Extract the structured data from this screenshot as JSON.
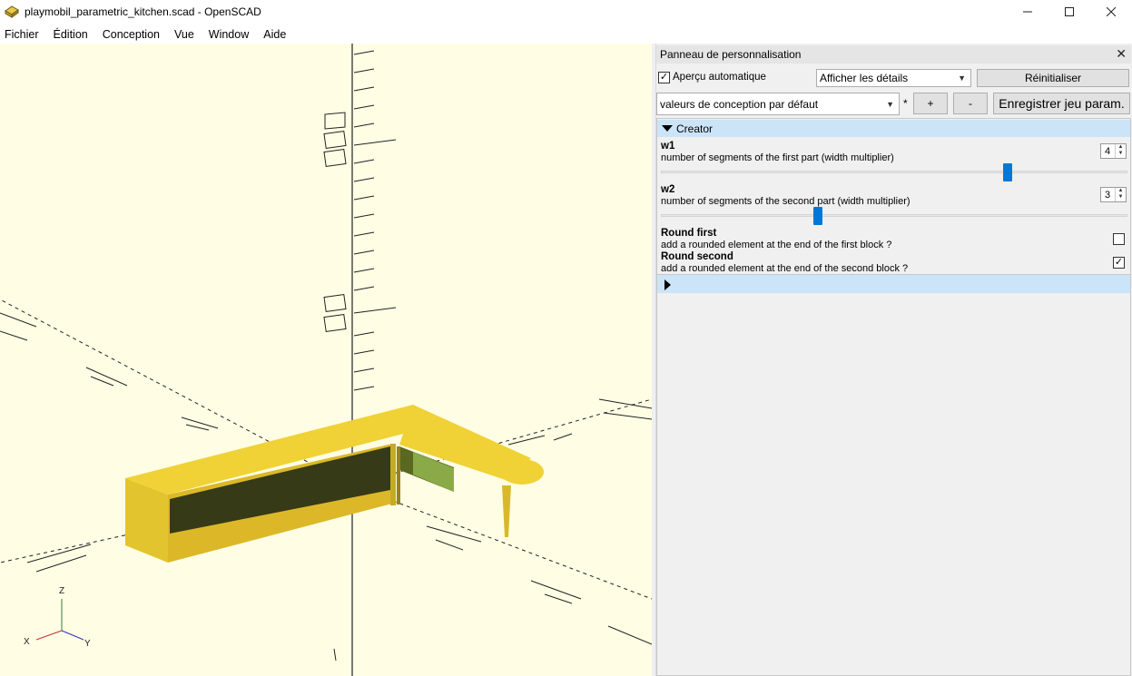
{
  "window": {
    "title": "playmobil_parametric_kitchen.scad - OpenSCAD",
    "controls": [
      "minimize",
      "maximize",
      "close"
    ]
  },
  "menu": [
    "Fichier",
    "Édition",
    "Conception",
    "Vue",
    "Window",
    "Aide"
  ],
  "viewport": {
    "background": "#fffee5",
    "axis_labels": {
      "x": "X",
      "y": "Y",
      "z": "Z"
    },
    "model_color": "#eac72c"
  },
  "panel": {
    "title": "Panneau de personnalisation",
    "close_glyph": "✕",
    "auto_preview": {
      "label": "Aperçu automatique",
      "checked": true
    },
    "details_select": "Afficher les détails",
    "reset_label": "Réinitialiser",
    "preset_select": "valeurs de conception par défaut",
    "modified_marker": "*",
    "plus_label": "+",
    "minus_label": "-",
    "save_label": "Enregistrer jeu param.",
    "group": {
      "title": "Creator",
      "params": [
        {
          "name": "w1",
          "description": "number of segments of the first part (width multiplier)",
          "value": "4",
          "slider_fraction": 0.75
        },
        {
          "name": "w2",
          "description": "number of segments of the second part (width multiplier)",
          "value": "3",
          "slider_fraction": 0.34
        }
      ],
      "checks": [
        {
          "name": "Round first",
          "description": "add a rounded element at the end of the first block ?",
          "checked": false
        },
        {
          "name": "Round second",
          "description": "add a rounded element at the end of the second block ?",
          "checked": true
        }
      ]
    }
  },
  "colors": {
    "accent": "#0078d7",
    "group_header": "#cce4f7",
    "panel_bg": "#f0f0f0"
  }
}
